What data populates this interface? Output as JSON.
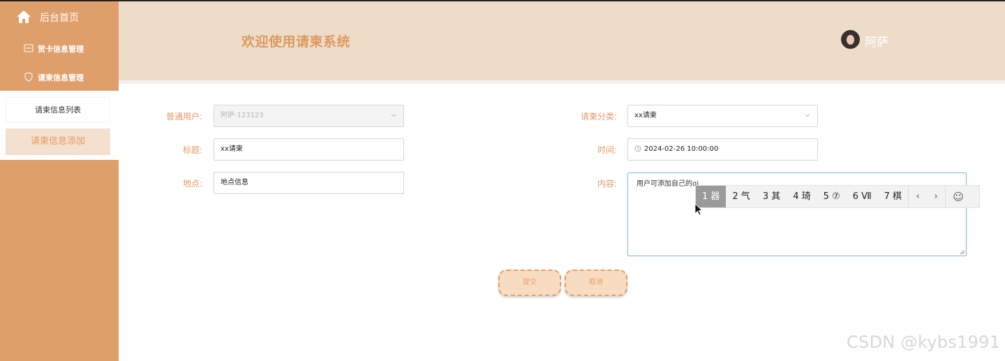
{
  "sidebar": {
    "home_label": "后台首页",
    "menus": [
      {
        "label": "贺卡信息管理",
        "icon": "card-icon"
      },
      {
        "label": "请柬信息管理",
        "icon": "shield-icon"
      }
    ],
    "submenu": {
      "list_label": "请柬信息列表",
      "add_label": "请柬信息添加"
    }
  },
  "header": {
    "title": "欢迎使用请柬系统",
    "user_name": "阿萨"
  },
  "form": {
    "user_label": "普通用户:",
    "user_value": "阿萨-123123",
    "title_label": "标题:",
    "title_value": "xx请柬",
    "location_label": "地点:",
    "location_value": "地点信息",
    "category_label": "请柬分类:",
    "category_value": "xx请柬",
    "time_label": "时间:",
    "time_value": "2024-02-26 10:00:00",
    "content_label": "内容:",
    "content_value": "用户可添加自己的qi",
    "submit_label": "提交",
    "cancel_label": "取消"
  },
  "ime": {
    "candidates": [
      "1 器",
      "2 气",
      "3 其",
      "4 琦",
      "5 ⑦",
      "6 Ⅶ",
      "7 棋"
    ],
    "prev": "‹",
    "next": "›",
    "emoji": "☺"
  },
  "watermark": "CSDN @kybs1991",
  "colors": {
    "sidebar": "#df9f6a",
    "header": "#eddcc8",
    "accent": "#dd9a5f"
  }
}
